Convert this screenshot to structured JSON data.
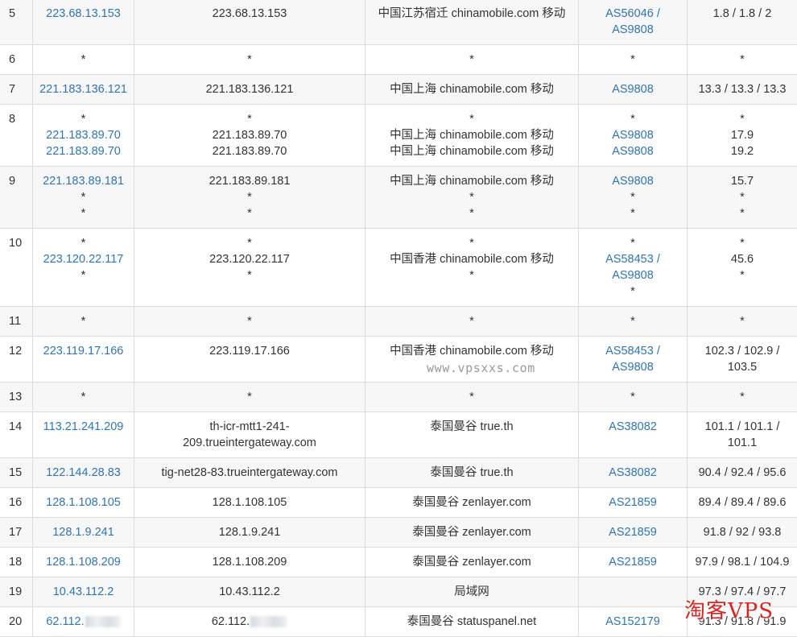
{
  "rows": [
    {
      "hop": "5",
      "ip": [
        "223.68.13.153"
      ],
      "host": [
        "223.68.13.153"
      ],
      "geo": [
        "中国江苏宿迁 chinamobile.com 移动"
      ],
      "asn": [
        "AS56046 /",
        "AS9808"
      ],
      "rtt": [
        "1.8 / 1.8 / 2"
      ]
    },
    {
      "hop": "6",
      "ip": [
        "*"
      ],
      "host": [
        "*"
      ],
      "geo": [
        "*"
      ],
      "asn": [
        "*"
      ],
      "rtt": [
        "*"
      ]
    },
    {
      "hop": "7",
      "ip": [
        "221.183.136.121"
      ],
      "host": [
        "221.183.136.121"
      ],
      "geo": [
        "中国上海 chinamobile.com 移动"
      ],
      "asn": [
        "AS9808"
      ],
      "rtt": [
        "13.3 / 13.3 / 13.3"
      ]
    },
    {
      "hop": "8",
      "ip": [
        "*",
        "221.183.89.70",
        "221.183.89.70"
      ],
      "host": [
        "*",
        "221.183.89.70",
        "221.183.89.70"
      ],
      "geo": [
        "*",
        "中国上海 chinamobile.com 移动",
        "中国上海 chinamobile.com 移动"
      ],
      "asn": [
        "*",
        "AS9808",
        "AS9808"
      ],
      "rtt": [
        "*",
        "17.9",
        "19.2"
      ]
    },
    {
      "hop": "9",
      "ip": [
        "221.183.89.181",
        "*",
        "*"
      ],
      "host": [
        "221.183.89.181",
        "*",
        "*"
      ],
      "geo": [
        "中国上海 chinamobile.com 移动",
        "*",
        "*"
      ],
      "asn": [
        "AS9808",
        "*",
        "*"
      ],
      "rtt": [
        "15.7",
        "*",
        "*"
      ]
    },
    {
      "hop": "10",
      "ip": [
        "*",
        "223.120.22.117",
        "*"
      ],
      "host": [
        "*",
        "223.120.22.117",
        "*"
      ],
      "geo": [
        "*",
        "中国香港 chinamobile.com 移动",
        "*"
      ],
      "asn": [
        "*",
        "AS58453 /",
        "AS9808",
        "*"
      ],
      "rtt": [
        "*",
        "45.6",
        "*"
      ]
    },
    {
      "hop": "11",
      "ip": [
        "*"
      ],
      "host": [
        "*"
      ],
      "geo": [
        "*"
      ],
      "asn": [
        "*"
      ],
      "rtt": [
        "*"
      ]
    },
    {
      "hop": "12",
      "ip": [
        "223.119.17.166"
      ],
      "host": [
        "223.119.17.166"
      ],
      "geo": [
        "中国香港 chinamobile.com 移动"
      ],
      "asn": [
        "AS58453 /",
        "AS9808"
      ],
      "rtt": [
        "102.3 / 102.9 /",
        "103.5"
      ]
    },
    {
      "hop": "13",
      "ip": [
        "*"
      ],
      "host": [
        "*"
      ],
      "geo": [
        "*"
      ],
      "asn": [
        "*"
      ],
      "rtt": [
        "*"
      ]
    },
    {
      "hop": "14",
      "ip": [
        "113.21.241.209"
      ],
      "host": [
        "th-icr-mtt1-241-",
        "209.trueintergateway.com"
      ],
      "geo": [
        "泰国曼谷 true.th"
      ],
      "asn": [
        "AS38082"
      ],
      "rtt": [
        "101.1 / 101.1 /",
        "101.1"
      ]
    },
    {
      "hop": "15",
      "ip": [
        "122.144.28.83"
      ],
      "host": [
        "tig-net28-83.trueintergateway.com"
      ],
      "geo": [
        "泰国曼谷 true.th"
      ],
      "asn": [
        "AS38082"
      ],
      "rtt": [
        "90.4 / 92.4 / 95.6"
      ]
    },
    {
      "hop": "16",
      "ip": [
        "128.1.108.105"
      ],
      "host": [
        "128.1.108.105"
      ],
      "geo": [
        "泰国曼谷 zenlayer.com"
      ],
      "asn": [
        "AS21859"
      ],
      "rtt": [
        "89.4 / 89.4 / 89.6"
      ]
    },
    {
      "hop": "17",
      "ip": [
        "128.1.9.241"
      ],
      "host": [
        "128.1.9.241"
      ],
      "geo": [
        "泰国曼谷 zenlayer.com"
      ],
      "asn": [
        "AS21859"
      ],
      "rtt": [
        "91.8 / 92 / 93.8"
      ]
    },
    {
      "hop": "18",
      "ip": [
        "128.1.108.209"
      ],
      "host": [
        "128.1.108.209"
      ],
      "geo": [
        "泰国曼谷 zenlayer.com"
      ],
      "asn": [
        "AS21859"
      ],
      "rtt": [
        "97.9 / 98.1 / 104.9"
      ]
    },
    {
      "hop": "19",
      "ip": [
        "10.43.112.2"
      ],
      "host": [
        "10.43.112.2"
      ],
      "geo": [
        "局域网"
      ],
      "asn": [],
      "rtt": [
        "97.3 / 97.4 / 97.7"
      ]
    },
    {
      "hop": "20",
      "ip": [
        "62.112."
      ],
      "host": [
        "62.112."
      ],
      "geo": [
        "泰国曼谷 statuspanel.net"
      ],
      "asn": [
        "AS152179"
      ],
      "rtt": [
        "91.3 / 91.8 / 91.9"
      ],
      "redacted": true
    }
  ],
  "watermarks": {
    "site": "www.vpsxxs.com",
    "brand": "淘客VPS"
  },
  "colors": {
    "link": "#2f75b5",
    "text": "#333333",
    "stripe": "#f7f7f7",
    "border": "#dcdcdc",
    "brand": "#e0221f"
  }
}
